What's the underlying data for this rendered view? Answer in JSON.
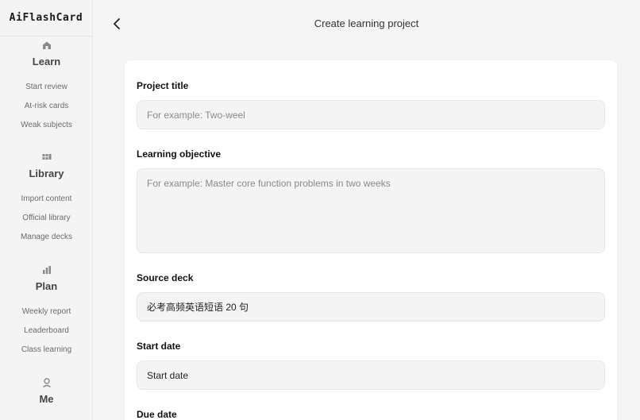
{
  "app": {
    "brand": "AiFlashCard"
  },
  "sidebar": {
    "groups": [
      {
        "icon": "home-icon",
        "title": "Learn",
        "items": [
          "Start review",
          "At-risk cards",
          "Weak subjects"
        ]
      },
      {
        "icon": "library-icon",
        "title": "Library",
        "items": [
          "Import content",
          "Official library",
          "Manage decks"
        ]
      },
      {
        "icon": "plan-icon",
        "title": "Plan",
        "items": [
          "Weekly report",
          "Leaderboard",
          "Class learning"
        ]
      },
      {
        "icon": "user-icon",
        "title": "Me",
        "items": []
      }
    ]
  },
  "header": {
    "title": "Create learning project"
  },
  "form": {
    "project_title": {
      "label": "Project title",
      "placeholder": "For example: Two-weel"
    },
    "objective": {
      "label": "Learning objective",
      "placeholder": "For example: Master core function problems in two weeks"
    },
    "source_deck": {
      "label": "Source deck",
      "value": "必考高频英语短语 20 句"
    },
    "start_date": {
      "label": "Start date",
      "value": "Start date"
    },
    "due_date": {
      "label": "Due date"
    }
  }
}
